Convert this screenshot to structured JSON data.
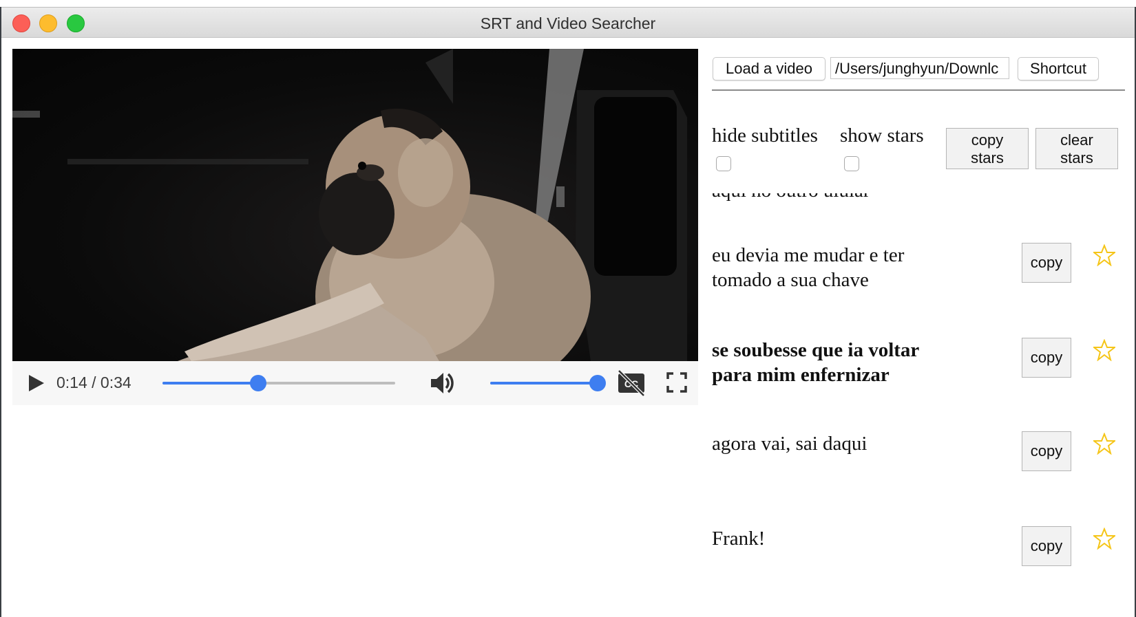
{
  "window": {
    "title": "SRT and Video Searcher"
  },
  "player": {
    "time_display": "0:14 / 0:34",
    "progress": 0.412,
    "volume": 1.0,
    "icons": [
      "play-icon",
      "volume-icon",
      "closed-captions-off-icon",
      "fullscreen-icon"
    ]
  },
  "toolbar": {
    "load_label": "Load a video",
    "path_value": "/Users/junghyun/Downlc",
    "shortcut_label": "Shortcut"
  },
  "options": {
    "hide_subtitles_label": "hide subtitles",
    "show_stars_label": "show stars",
    "copy_stars_label_line1": "copy",
    "copy_stars_label_line2": "stars",
    "clear_stars_label_line1": "clear",
    "clear_stars_label_line2": "stars"
  },
  "subtitles": {
    "clipped_text": "aqui no outro ulular",
    "copy_label": "copy",
    "items": [
      {
        "line1": "eu devia me mudar e ter",
        "line2": "tomado a sua chave"
      },
      {
        "line1": "se soubesse que ia voltar",
        "line2": "para mim enfernizar"
      },
      {
        "line1": "agora vai, sai daqui",
        "line2": ""
      },
      {
        "line1": "Frank!",
        "line2": ""
      }
    ]
  },
  "colors": {
    "accent": "#3e7ef0",
    "star": "#f5c518"
  }
}
